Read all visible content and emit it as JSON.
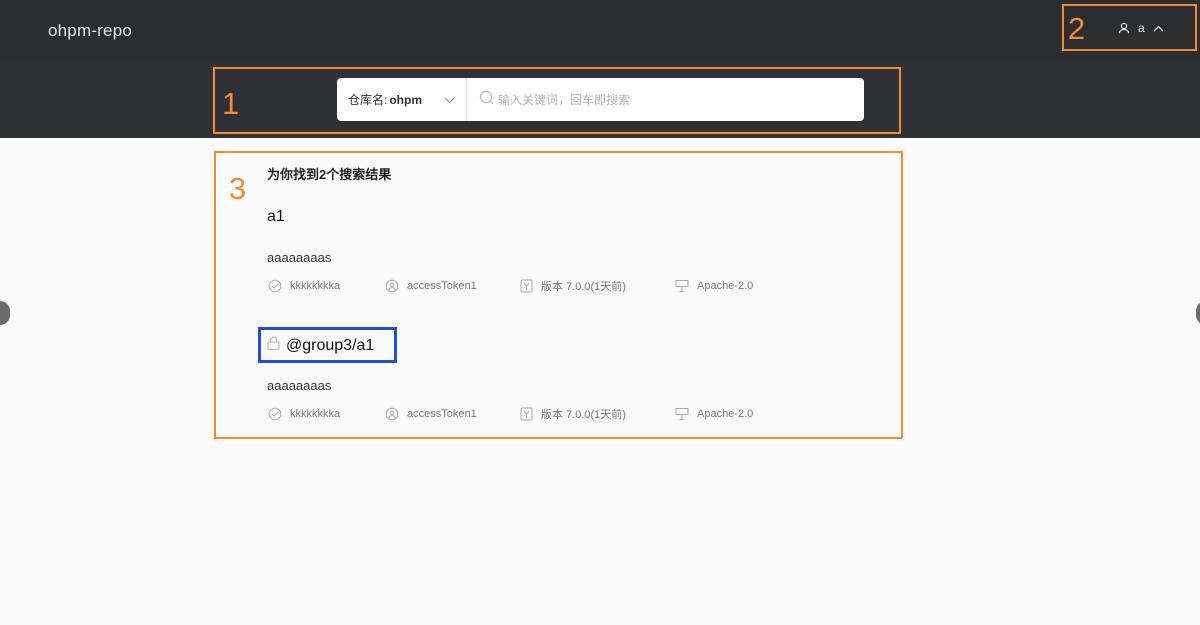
{
  "header": {
    "logo": "ohpm-repo",
    "user_name": "a"
  },
  "search": {
    "repo_label": "仓库名:",
    "repo_value": "ohpm",
    "placeholder": "输入关键词，回车即搜索"
  },
  "annotations": [
    "1",
    "2",
    "3"
  ],
  "results": {
    "count_text": "为你找到2个搜索结果",
    "items": [
      {
        "name": "a1",
        "private": false,
        "description": "aaaaaaaas",
        "publisher": "kkkkkkkka",
        "user": "accessToken1",
        "version": "版本 7.0.0(1天前)",
        "license": "Apache-2.0"
      },
      {
        "name": "@group3/a1",
        "private": true,
        "description": "aaaaaaaas",
        "publisher": "kkkkkkkka",
        "user": "accessToken1",
        "version": "版本 7.0.0(1天前)",
        "license": "Apache-2.0"
      }
    ]
  },
  "colors": {
    "annotation": "#f08a33",
    "highlight": "#1f4fd8",
    "header_bg": "#2c2d2f"
  }
}
